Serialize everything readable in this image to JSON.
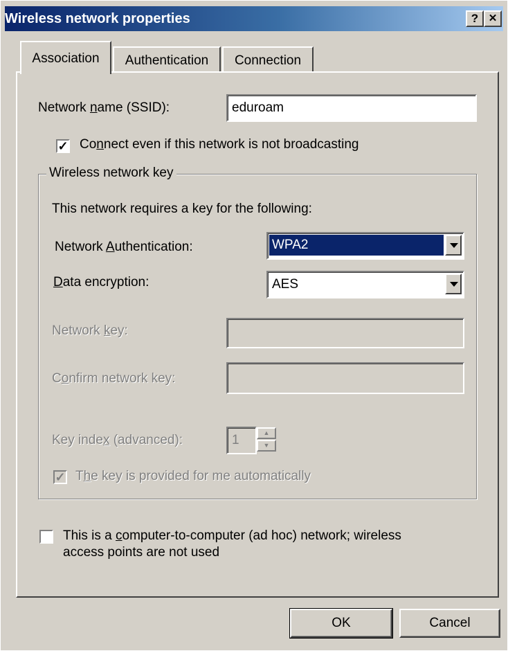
{
  "window": {
    "title": "Wireless network properties",
    "help_button": "?",
    "close_button": "✕"
  },
  "tabs": [
    {
      "label": "Association",
      "active": true
    },
    {
      "label": "Authentication",
      "active": false
    },
    {
      "label": "Connection",
      "active": false
    }
  ],
  "association": {
    "ssid_label_pre": "Network ",
    "ssid_label_u": "n",
    "ssid_label_post": "ame (SSID):",
    "ssid_value": "eduroam",
    "connect_checkbox": {
      "checked": true,
      "label_pre": "Co",
      "label_u": "n",
      "label_post": "nect even if this network is not broadcasting"
    },
    "key_group": {
      "title": "Wireless network key",
      "intro": "This network requires a key for the following:",
      "auth_label_pre": "Network ",
      "auth_label_u": "A",
      "auth_label_post": "uthentication:",
      "auth_value": "WPA2",
      "enc_label_u": "D",
      "enc_label_post": "ata encryption:",
      "enc_value": "AES",
      "netkey_label_pre": "Network ",
      "netkey_label_u": "k",
      "netkey_label_post": "ey:",
      "confirm_label_pre": "C",
      "confirm_label_u": "o",
      "confirm_label_post": "nfirm network key:",
      "index_label_pre": "Key inde",
      "index_label_u": "x",
      "index_label_post": " (advanced):",
      "index_value": "1",
      "auto_checkbox": {
        "checked": true,
        "label_pre": "T",
        "label_u": "h",
        "label_post": "e key is provided for me automatically"
      }
    },
    "adhoc_checkbox": {
      "checked": false,
      "line1_pre": "This is a ",
      "line1_u": "c",
      "line1_post": "omputer-to-computer (ad hoc) network; wireless",
      "line2": "access points are not used"
    }
  },
  "buttons": {
    "ok": "OK",
    "cancel": "Cancel"
  },
  "colors": {
    "title_gradient_start": "#0a246a",
    "title_gradient_end": "#a6caf0",
    "selected_bg": "#0a246a",
    "face": "#d4d0c8"
  }
}
